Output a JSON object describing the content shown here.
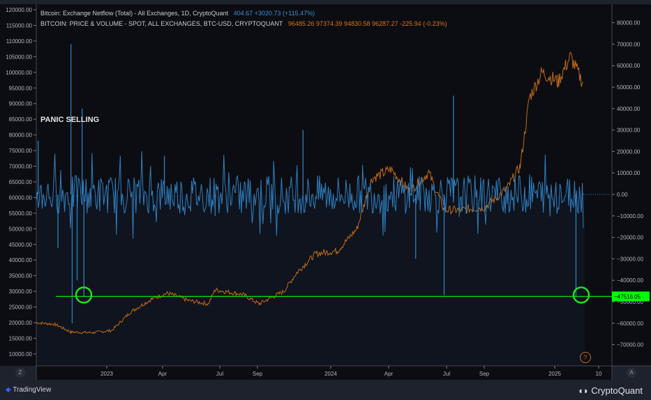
{
  "legend": {
    "netflow_title": "Bitcoin: Exchange Netflow (Total) - All Exchanges, 1D, CryptoQuant",
    "netflow_values": "404.67 +3020.73 (+115.47%)",
    "price_title": "BITCOIN: PRICE & VOLUME - SPOT, ALL EXCHANGES, BTC-USD, CRYPTOQUANT",
    "price_values": "96485.26 97374.39 94830.58 96287.27 -225.94 (-0.23%)"
  },
  "annotation": "PANIC SELLING",
  "branding": {
    "left": "TradingView",
    "right": "CryptoQuant"
  },
  "buttons": {
    "left_axis": "Z",
    "right_axis": "A",
    "help": "?"
  },
  "colors": {
    "netflow": "#2f7fc1",
    "price": "#c06a1a",
    "support_line": "#00e600",
    "highlight_circle": "#22e022",
    "background": "#0c0d12"
  },
  "chart_data": {
    "type": "line",
    "left_axis": {
      "label": "",
      "ylim": [
        10000,
        120000
      ],
      "ticks": [
        120000,
        115000,
        110000,
        105000,
        100000,
        95000,
        90000,
        85000,
        80000,
        75000,
        70000,
        65000,
        60000,
        55000,
        50000,
        45000,
        40000,
        35000,
        30000,
        25000,
        20000,
        15000,
        10000
      ]
    },
    "right_axis": {
      "label": "",
      "ylim": [
        -70000,
        80000
      ],
      "ticks": [
        80000,
        70000,
        60000,
        50000,
        40000,
        30000,
        20000,
        10000,
        0,
        -10000,
        -20000,
        -30000,
        -40000,
        -50000,
        -60000,
        -70000
      ]
    },
    "x_ticks": [
      "2023",
      "Apr",
      "Jul",
      "Sep",
      "2024",
      "Apr",
      "Jul",
      "Sep",
      "2025",
      "10"
    ],
    "series": [
      {
        "axis": "left",
        "points": [
          [
            "2022-09-15",
            20000
          ],
          [
            "2022-10-15",
            19500
          ],
          [
            "2022-11-10",
            17000
          ],
          [
            "2022-12-15",
            16800
          ],
          [
            "2023-01-15",
            17500
          ],
          [
            "2023-02-15",
            23500
          ],
          [
            "2023-03-20",
            27500
          ],
          [
            "2023-04-15",
            29500
          ],
          [
            "2023-05-20",
            27000
          ],
          [
            "2023-06-20",
            26000
          ],
          [
            "2023-07-01",
            30500
          ],
          [
            "2023-08-15",
            29000
          ],
          [
            "2023-09-10",
            26000
          ],
          [
            "2023-10-20",
            30000
          ],
          [
            "2023-11-10",
            36000
          ],
          [
            "2023-12-10",
            42000
          ],
          [
            "2024-01-15",
            43000
          ],
          [
            "2024-02-15",
            50000
          ],
          [
            "2024-03-10",
            66000
          ],
          [
            "2024-04-10",
            69000
          ],
          [
            "2024-05-10",
            62000
          ],
          [
            "2024-06-10",
            68000
          ],
          [
            "2024-07-05",
            56000
          ],
          [
            "2024-08-05",
            56000
          ],
          [
            "2024-09-10",
            57000
          ],
          [
            "2024-10-15",
            63000
          ],
          [
            "2024-11-05",
            70000
          ],
          [
            "2024-11-20",
            92000
          ],
          [
            "2024-12-10",
            100000
          ],
          [
            "2025-01-05",
            97000
          ],
          [
            "2025-01-25",
            105000
          ],
          [
            "2025-02-15",
            96287
          ]
        ]
      },
      {
        "axis": "right",
        "baseline": 0,
        "spikes": [
          [
            "2022-09-18",
            25000
          ],
          [
            "2022-10-20",
            -25000
          ],
          [
            "2022-11-10",
            70000
          ],
          [
            "2022-11-12",
            -60000
          ],
          [
            "2022-11-20",
            -40000
          ],
          [
            "2022-11-28",
            40000
          ],
          [
            "2022-12-01",
            -47516
          ],
          [
            "2023-04-10",
            18000
          ],
          [
            "2023-07-01",
            -10000
          ],
          [
            "2023-11-20",
            30000
          ],
          [
            "2024-05-20",
            -30000
          ],
          [
            "2024-07-05",
            -47000
          ],
          [
            "2024-07-20",
            46000
          ],
          [
            "2025-02-03",
            -47516
          ],
          [
            "2025-02-15",
            404.67
          ]
        ]
      }
    ],
    "horizontal_line": {
      "value": -47516.05,
      "label": "-47516.05"
    },
    "grid": false
  }
}
